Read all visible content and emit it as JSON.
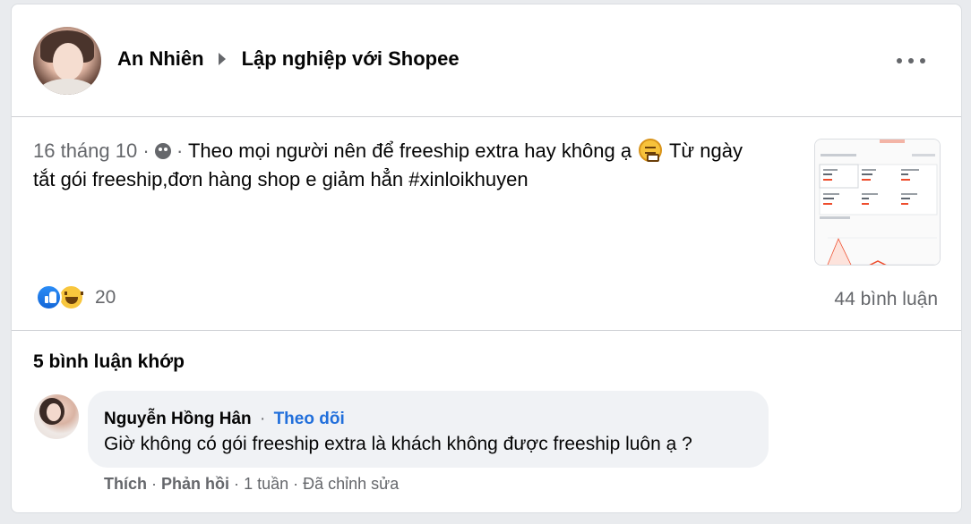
{
  "post": {
    "author": "An Nhiên",
    "group": "Lập nghiệp với Shopee",
    "date": "16 tháng 10",
    "separator": "·",
    "text": "Theo mọi người nên để freeship extra hay không ạ",
    "text_after_emoji": "Từ ngày",
    "text_line2": "tắt gói freeship,đơn hàng shop e giảm hẳn #xinloikhuyen",
    "reaction_count": "20",
    "comment_count": "44 bình luận"
  },
  "comments_section": {
    "title": "5 bình luận khớp",
    "comments": [
      {
        "name": "Nguyễn Hồng Hân",
        "follow_label": "Theo dõi",
        "text": "Giờ không có gói freeship extra là khách không được freeship luôn ạ ?",
        "like_label": "Thích",
        "reply_label": "Phản hồi",
        "time": "1 tuần",
        "edited_label": "Đã chỉnh sửa"
      }
    ]
  },
  "icons": {
    "more": "more-horizontal-icon",
    "privacy": "group-privacy-icon",
    "like": "like-reaction-icon",
    "haha": "haha-reaction-icon",
    "caret": "caret-right-icon"
  },
  "colors": {
    "link": "#216fdb",
    "muted": "#65676b",
    "like_blue": "#1877f2"
  }
}
